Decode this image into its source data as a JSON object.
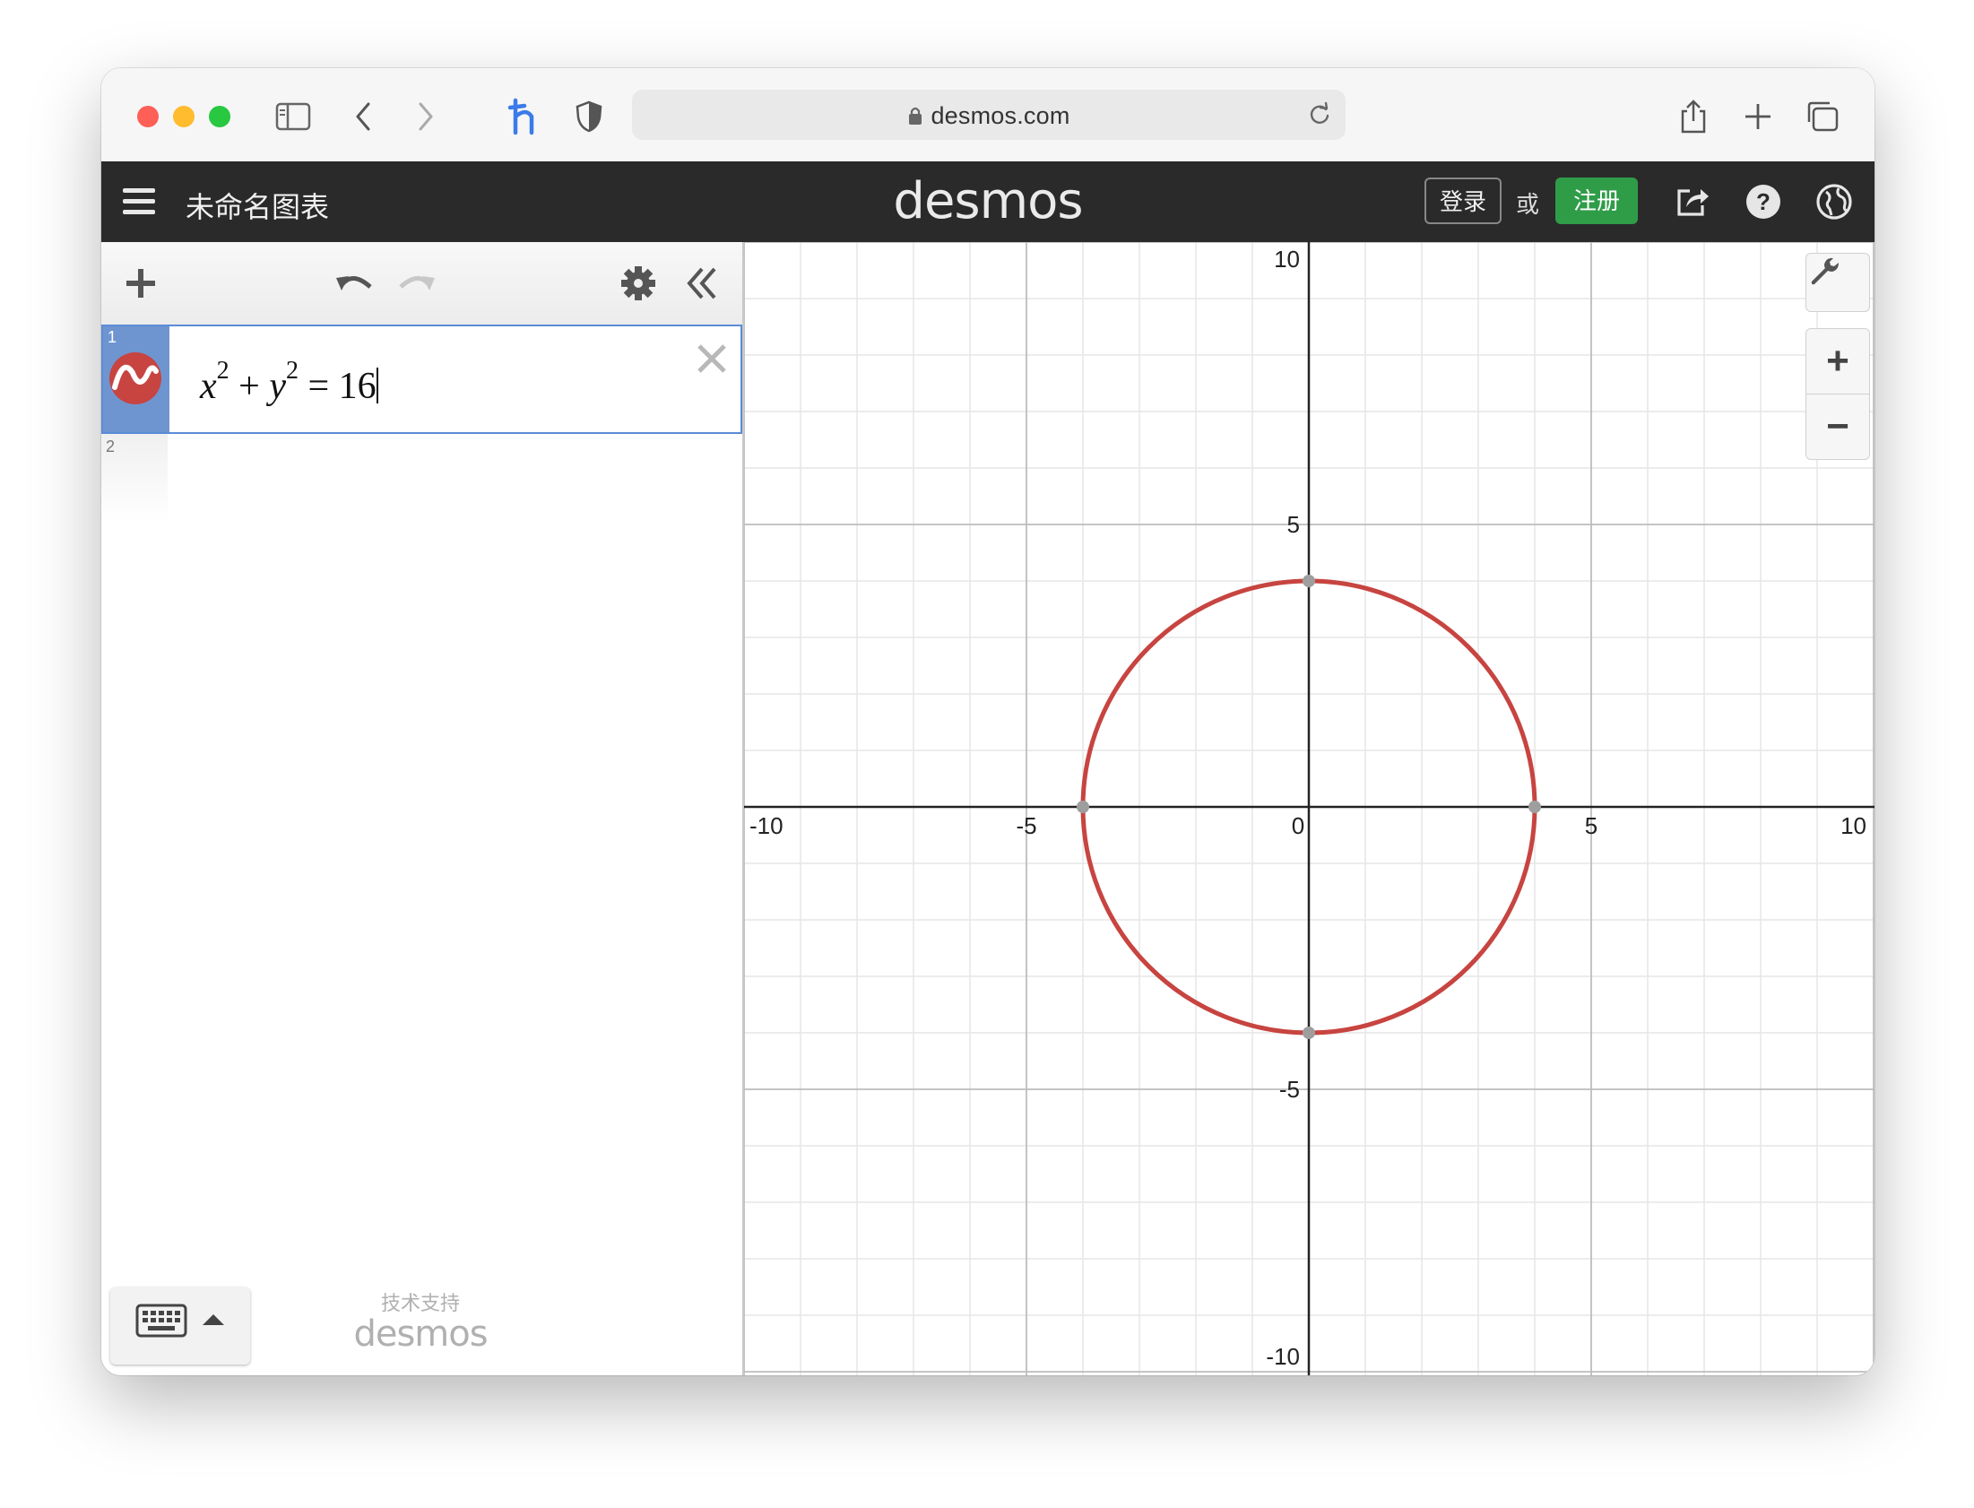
{
  "browser": {
    "url": "desmos.com",
    "icons": [
      "sidebar-icon",
      "back-icon",
      "forward-icon",
      "extension-h-icon",
      "shield-icon",
      "lock-icon",
      "reload-icon",
      "share-icon",
      "new-tab-icon",
      "tabs-icon"
    ]
  },
  "header": {
    "menu_icon": "hamburger-icon",
    "graph_title": "未命名图表",
    "brand": "desmos",
    "login_label": "登录",
    "or_label": "或",
    "signup_label": "注册",
    "icons": [
      "share-graph-icon",
      "help-icon",
      "language-globe-icon"
    ]
  },
  "expressions": {
    "toolbar_icons": [
      "add-icon",
      "undo-icon",
      "redo-icon",
      "settings-gear-icon",
      "collapse-panel-icon"
    ],
    "items": [
      {
        "index": "1",
        "latex": "x^2 + y^2 = 16",
        "color": "#c74440",
        "active": true
      },
      {
        "index": "2",
        "latex": "",
        "active": false
      }
    ],
    "keyboard_icon": "keyboard-icon",
    "powered_by_text": "技术支持",
    "powered_by_brand": "desmos"
  },
  "graph": {
    "xlim": [
      -10,
      10
    ],
    "ylim": [
      -10,
      10
    ],
    "major_step": 5,
    "minor_step": 1,
    "x_tick_labels": [
      "-10",
      "-5",
      "0",
      "5",
      "10"
    ],
    "y_tick_labels": [
      "10",
      "5",
      "-5",
      "-10"
    ],
    "curve": {
      "type": "circle",
      "equation": "x^2 + y^2 = 16",
      "center": [
        0,
        0
      ],
      "radius": 4,
      "color": "#c74440"
    },
    "points_of_interest": [
      [
        0,
        4
      ],
      [
        0,
        -4
      ],
      [
        -4,
        0
      ],
      [
        4,
        0
      ]
    ],
    "controls": {
      "settings_icon": "wrench-icon",
      "zoom_in": "+",
      "zoom_out": "−"
    }
  }
}
